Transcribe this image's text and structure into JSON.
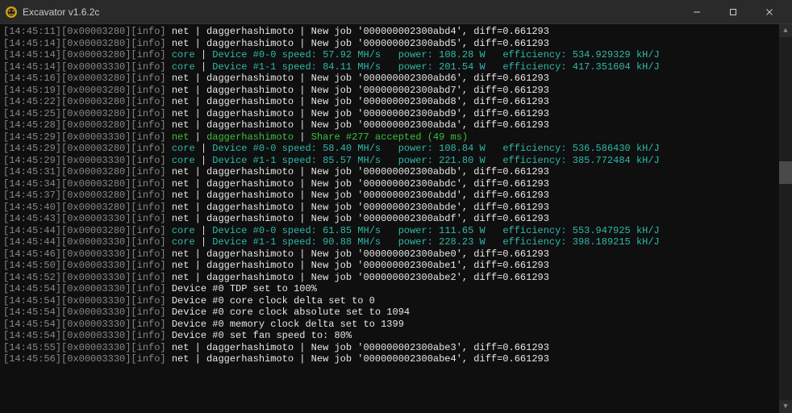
{
  "window": {
    "title": "Excavator v1.6.2c"
  },
  "lines": [
    {
      "type": "net",
      "ts": "14:45:11",
      "thr": "0x00003280",
      "job": "000000002300abd4",
      "diff": "0.661293"
    },
    {
      "type": "net",
      "ts": "14:45:14",
      "thr": "0x00003280",
      "job": "000000002300abd5",
      "diff": "0.661293"
    },
    {
      "type": "core",
      "ts": "14:45:14",
      "thr": "0x00003280",
      "dev": "0-0",
      "spd": "57.92",
      "pow": "108.28",
      "eff": "534.929329"
    },
    {
      "type": "core",
      "ts": "14:45:14",
      "thr": "0x00003330",
      "dev": "1-1",
      "spd": "84.11",
      "pow": "201.54",
      "eff": "417.351604"
    },
    {
      "type": "net",
      "ts": "14:45:16",
      "thr": "0x00003280",
      "job": "000000002300abd6",
      "diff": "0.661293"
    },
    {
      "type": "net",
      "ts": "14:45:19",
      "thr": "0x00003280",
      "job": "000000002300abd7",
      "diff": "0.661293"
    },
    {
      "type": "net",
      "ts": "14:45:22",
      "thr": "0x00003280",
      "job": "000000002300abd8",
      "diff": "0.661293"
    },
    {
      "type": "net",
      "ts": "14:45:25",
      "thr": "0x00003280",
      "job": "000000002300abd9",
      "diff": "0.661293"
    },
    {
      "type": "net",
      "ts": "14:45:28",
      "thr": "0x00003280",
      "job": "000000002300abda",
      "diff": "0.661293"
    },
    {
      "type": "share",
      "ts": "14:45:29",
      "thr": "0x00003330",
      "msg": "Share #277 accepted (49 ms)"
    },
    {
      "type": "core",
      "ts": "14:45:29",
      "thr": "0x00003280",
      "dev": "0-0",
      "spd": "58.40",
      "pow": "108.84",
      "eff": "536.586430"
    },
    {
      "type": "core",
      "ts": "14:45:29",
      "thr": "0x00003330",
      "dev": "1-1",
      "spd": "85.57",
      "pow": "221.80",
      "eff": "385.772484"
    },
    {
      "type": "net",
      "ts": "14:45:31",
      "thr": "0x00003280",
      "job": "000000002300abdb",
      "diff": "0.661293"
    },
    {
      "type": "net",
      "ts": "14:45:34",
      "thr": "0x00003280",
      "job": "000000002300abdc",
      "diff": "0.661293"
    },
    {
      "type": "net",
      "ts": "14:45:37",
      "thr": "0x00003280",
      "job": "000000002300abdd",
      "diff": "0.661293"
    },
    {
      "type": "net",
      "ts": "14:45:40",
      "thr": "0x00003280",
      "job": "000000002300abde",
      "diff": "0.661293"
    },
    {
      "type": "net",
      "ts": "14:45:43",
      "thr": "0x00003330",
      "job": "000000002300abdf",
      "diff": "0.661293"
    },
    {
      "type": "core",
      "ts": "14:45:44",
      "thr": "0x00003280",
      "dev": "0-0",
      "spd": "61.85",
      "pow": "111.65",
      "eff": "553.947925"
    },
    {
      "type": "core",
      "ts": "14:45:44",
      "thr": "0x00003330",
      "dev": "1-1",
      "spd": "90.88",
      "pow": "228.23",
      "eff": "398.189215"
    },
    {
      "type": "net",
      "ts": "14:45:46",
      "thr": "0x00003330",
      "job": "000000002300abe0",
      "diff": "0.661293"
    },
    {
      "type": "net",
      "ts": "14:45:50",
      "thr": "0x00003330",
      "job": "000000002300abe1",
      "diff": "0.661293"
    },
    {
      "type": "net",
      "ts": "14:45:52",
      "thr": "0x00003330",
      "job": "000000002300abe2",
      "diff": "0.661293"
    },
    {
      "type": "info",
      "ts": "14:45:54",
      "thr": "0x00003330",
      "msg": "Device #0 TDP set to 100%"
    },
    {
      "type": "info",
      "ts": "14:45:54",
      "thr": "0x00003330",
      "msg": "Device #0 core clock delta set to 0"
    },
    {
      "type": "info",
      "ts": "14:45:54",
      "thr": "0x00003330",
      "msg": "Device #0 core clock absolute set to 1094"
    },
    {
      "type": "info",
      "ts": "14:45:54",
      "thr": "0x00003330",
      "msg": "Device #0 memory clock delta set to 1399"
    },
    {
      "type": "info",
      "ts": "14:45:54",
      "thr": "0x00003330",
      "msg": "Device #0 set fan speed to: 80%"
    },
    {
      "type": "net",
      "ts": "14:45:55",
      "thr": "0x00003330",
      "job": "000000002300abe3",
      "diff": "0.661293"
    },
    {
      "type": "net",
      "ts": "14:45:56",
      "thr": "0x00003330",
      "job": "000000002300abe4",
      "diff": "0.661293"
    }
  ]
}
